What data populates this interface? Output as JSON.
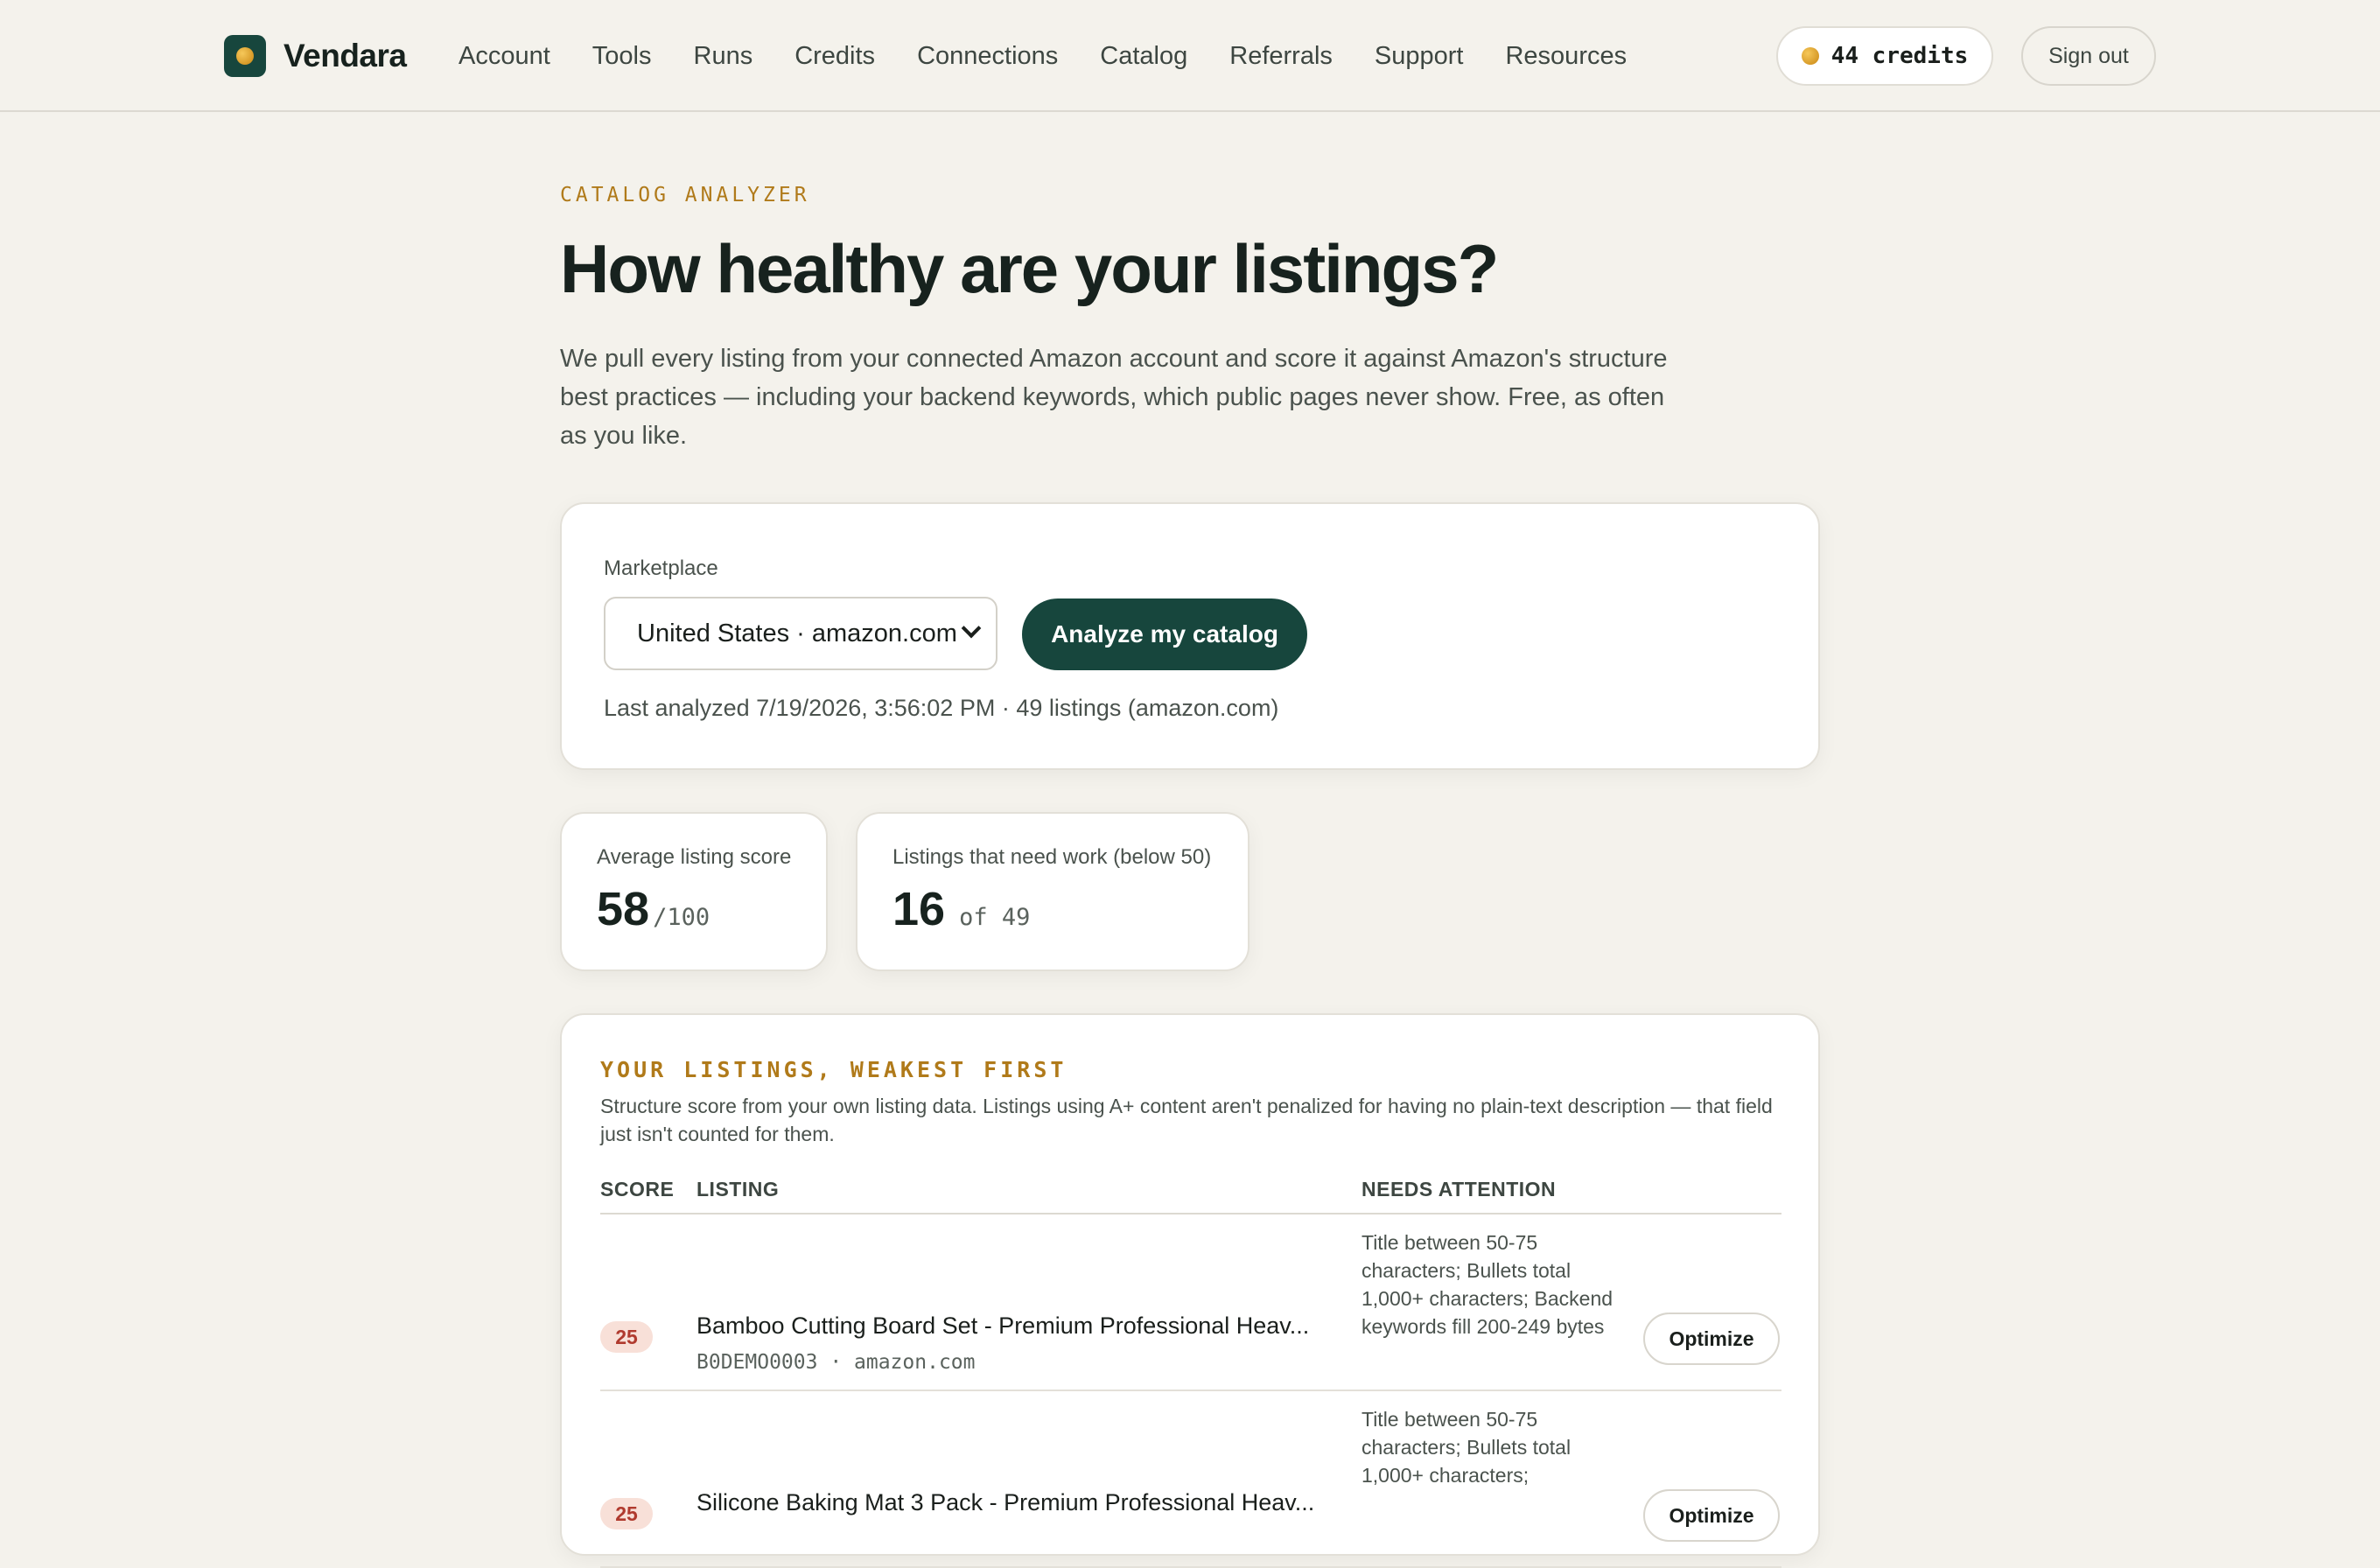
{
  "header": {
    "brand": "Vendara",
    "nav": [
      "Account",
      "Tools",
      "Runs",
      "Credits",
      "Connections",
      "Catalog",
      "Referrals",
      "Support",
      "Resources"
    ],
    "credits": "44 credits",
    "sign_out": "Sign out"
  },
  "hero": {
    "eyebrow": "CATALOG ANALYZER",
    "title": "How healthy are your listings?",
    "intro": "We pull every listing from your connected Amazon account and score it against Amazon's structure best practices — including your backend keywords, which public pages never show. Free, as often as you like."
  },
  "analyze": {
    "marketplace_label": "Marketplace",
    "marketplace_value": "United States · amazon.com",
    "button": "Analyze my catalog",
    "last_analyzed": "Last analyzed 7/19/2026, 3:56:02 PM · 49 listings (amazon.com)"
  },
  "stats": {
    "avg_label": "Average listing score",
    "avg_value": "58",
    "avg_suffix": "/100",
    "need_label": "Listings that need work (below 50)",
    "need_value": "16",
    "need_suffix": "of 49"
  },
  "listings": {
    "eyebrow": "YOUR LISTINGS, WEAKEST FIRST",
    "description": "Structure score from your own listing data. Listings using A+ content aren't penalized for having no plain-text description — that field just isn't counted for them.",
    "columns": {
      "score": "SCORE",
      "listing": "LISTING",
      "attention": "NEEDS ATTENTION"
    },
    "rows": [
      {
        "score": "25",
        "title": "Bamboo Cutting Board Set - Premium Professional Heav...",
        "sub": "B0DEMO0003 · amazon.com",
        "attention": "Title between 50-75 characters; Bullets total 1,000+ characters; Backend keywords fill 200-249 bytes",
        "action": "Optimize"
      },
      {
        "score": "25",
        "title": "Silicone Baking Mat 3 Pack - Premium Professional Heav...",
        "sub": "",
        "attention": "Title between 50-75 characters; Bullets total 1,000+ characters;",
        "action": "Optimize"
      }
    ]
  }
}
